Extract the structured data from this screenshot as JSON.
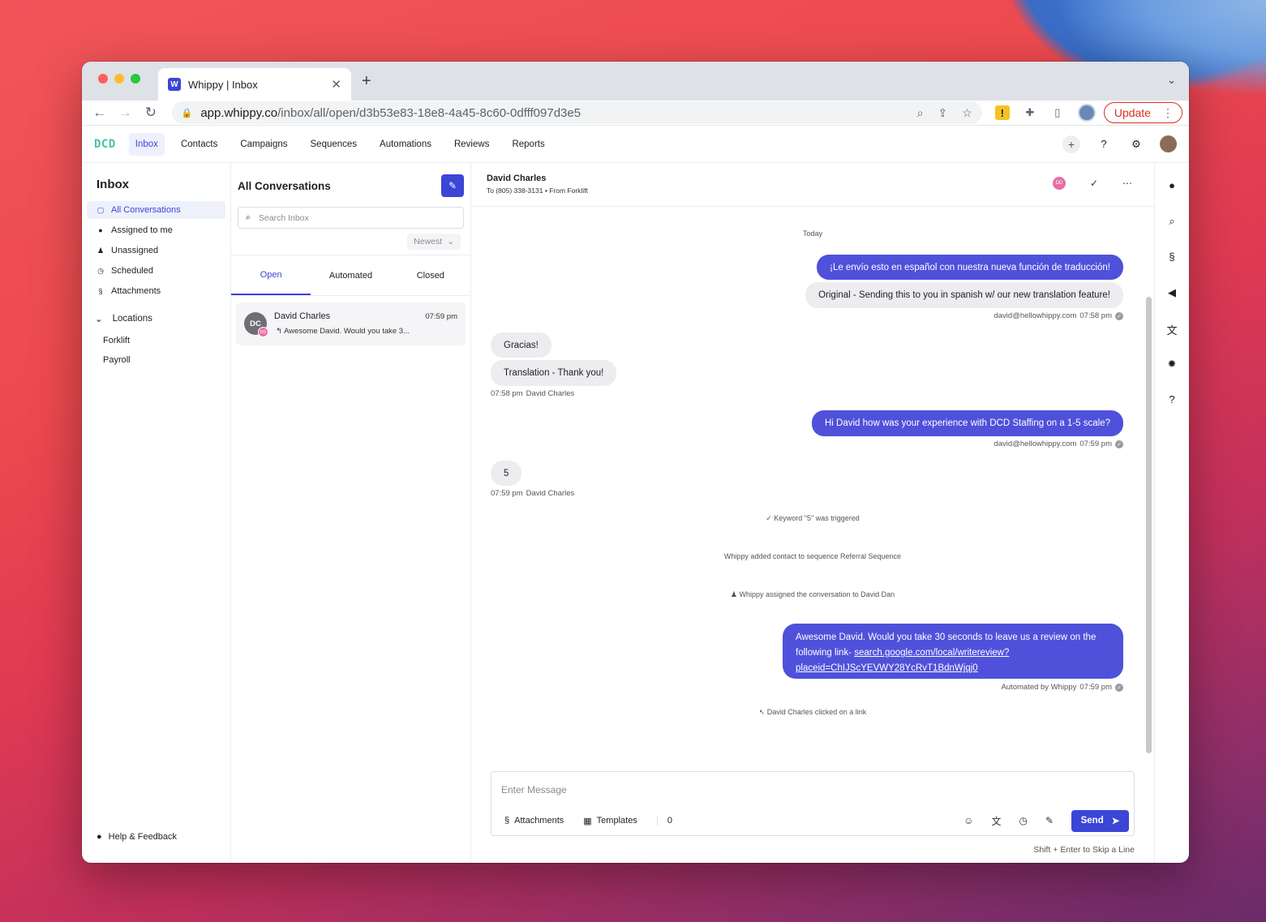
{
  "browser": {
    "tab_title": "Whippy | Inbox",
    "url_host": "app.whippy.co",
    "url_path": "/inbox/all/open/d3b53e83-18e8-4a45-8c60-0dfff097d3e5",
    "update_label": "Update"
  },
  "app": {
    "logo": "DCD",
    "nav": [
      "Inbox",
      "Contacts",
      "Campaigns",
      "Sequences",
      "Automations",
      "Reviews",
      "Reports"
    ]
  },
  "sidebar": {
    "title": "Inbox",
    "items": [
      {
        "label": "All Conversations",
        "icon": "inbox-icon"
      },
      {
        "label": "Assigned to me",
        "icon": "user-circle-icon"
      },
      {
        "label": "Unassigned",
        "icon": "user-minus-icon"
      },
      {
        "label": "Scheduled",
        "icon": "clock-icon"
      },
      {
        "label": "Attachments",
        "icon": "paperclip-icon"
      }
    ],
    "locations_label": "Locations",
    "locations": [
      "Forklift",
      "Payroll"
    ],
    "help": "Help & Feedback"
  },
  "conversations": {
    "title": "All Conversations",
    "search_placeholder": "Search Inbox",
    "sort": "Newest",
    "tabs": [
      "Open",
      "Automated",
      "Closed"
    ],
    "items": [
      {
        "initials": "DC",
        "badge": "DD",
        "name": "David Charles",
        "time": "07:59 pm",
        "preview": "Awesome David. Would you take 3..."
      }
    ]
  },
  "chat": {
    "name": "David Charles",
    "to": "To (805) 338-3131",
    "from": "From Forklift",
    "assignee_badge": "DD",
    "day": "Today",
    "m1_translated": "¡Le envío esto en español con nuestra nueva función de traducción!",
    "m1_original": "Original - Sending this to you in spanish w/ our new translation feature!",
    "m1_meta_sender": "david@hellowhippy.com",
    "m1_meta_time": "07:58 pm",
    "m2_text": "Gracias!",
    "m2_translation": "Translation - Thank you!",
    "m2_meta_time": "07:58 pm",
    "m2_meta_sender": "David Charles",
    "m3_text": "Hi David how was your experience with DCD Staffing on a 1-5 scale?",
    "m3_meta_sender": "david@hellowhippy.com",
    "m3_meta_time": "07:59 pm",
    "m4_text": "5",
    "m4_meta_time": "07:59 pm",
    "m4_meta_sender": "David Charles",
    "event_keyword": "Keyword \"5\" was triggered",
    "event_sequence": "Whippy added contact to sequence Referral Sequence",
    "event_assigned": "Whippy assigned the conversation to David Dan",
    "m5_text_a": "Awesome David. Would you take 30 seconds to leave us a review on the",
    "m5_text_b": "following link- ",
    "m5_link_a": "search.google.com/local/writereview?",
    "m5_link_b": "placeid=ChIJScYEVWY28YcRvT1BdnWjqj0",
    "m5_meta_sender": "Automated by Whippy",
    "m5_meta_time": "07:59 pm",
    "event_click": "David Charles clicked on a link"
  },
  "composer": {
    "placeholder": "Enter Message",
    "attachments": "Attachments",
    "templates": "Templates",
    "count": "0",
    "send": "Send",
    "hint": "Shift + Enter to Skip a Line"
  },
  "colors": {
    "accent": "#3b45d6",
    "outgoing": "#4f51db",
    "incoming": "#ededf0",
    "logo": "#4cc2a6"
  }
}
